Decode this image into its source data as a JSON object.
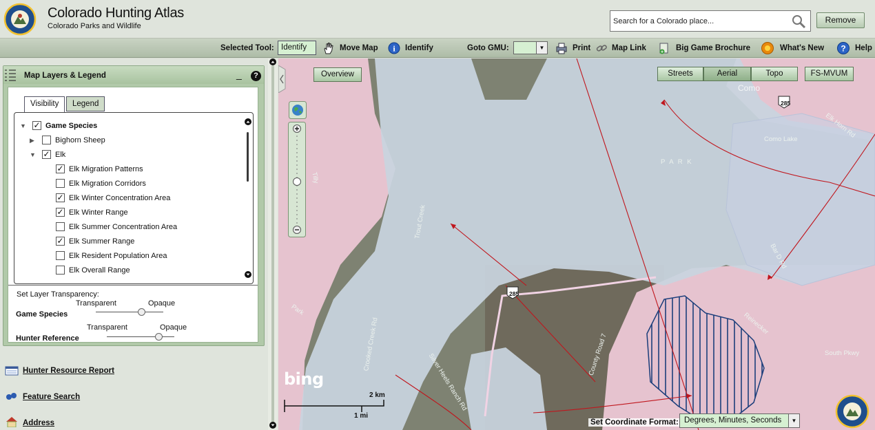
{
  "header": {
    "title": "Colorado Hunting Atlas",
    "subtitle": "Colorado Parks and Wildlife",
    "logo_text": "COLORADO PARKS & WILDLIFE",
    "search_placeholder": "Search for a Colorado place...",
    "remove_label": "Remove"
  },
  "toolbar": {
    "selected_tool_label": "Selected Tool:",
    "selected_tool_value": "Identify",
    "move_map": "Move Map",
    "identify": "Identify",
    "goto_gmu": "Goto GMU:",
    "print": "Print",
    "map_link": "Map Link",
    "big_game": "Big Game Brochure",
    "whats_new": "What's New",
    "help": "Help"
  },
  "layers_panel": {
    "title": "Map Layers & Legend",
    "minimize": "_",
    "help": "?",
    "tabs": [
      "Visibility",
      "Legend"
    ],
    "tree": [
      {
        "label": "Game Species",
        "checked": true,
        "bold": true,
        "expanded": true
      },
      {
        "label": "Bighorn Sheep",
        "checked": false,
        "expanded": false
      },
      {
        "label": "Elk",
        "checked": true,
        "expanded": true
      },
      {
        "label": "Elk Migration Patterns",
        "checked": true
      },
      {
        "label": "Elk Migration Corridors",
        "checked": false
      },
      {
        "label": "Elk Winter Concentration Area",
        "checked": true
      },
      {
        "label": "Elk Winter Range",
        "checked": true
      },
      {
        "label": "Elk Summer Concentration Area",
        "checked": false
      },
      {
        "label": "Elk Summer Range",
        "checked": true
      },
      {
        "label": "Elk Resident Population Area",
        "checked": false
      },
      {
        "label": "Elk Overall Range",
        "checked": false
      }
    ],
    "transparency_title": "Set Layer Transparency:",
    "transparent": "Transparent",
    "opaque": "Opaque",
    "sliders": [
      {
        "label": "Game Species",
        "value": 0.7
      },
      {
        "label": "Hunter Reference",
        "value": 0.8
      }
    ]
  },
  "links": [
    "Hunter Resource Report",
    "Feature Search",
    "Address"
  ],
  "map": {
    "overview": "Overview",
    "basemaps": [
      "Streets",
      "Aerial",
      "Topo"
    ],
    "active_basemap": "Aerial",
    "fs_mvum": "FS-MVUM",
    "scale_km": "2 km",
    "scale_mi": "1 mi",
    "bing": "bing",
    "zoom_level": 0.5,
    "labels": [
      "Como",
      "Elk Horn Rd",
      "Como Lake",
      "P A R K",
      "Tilly",
      "Trout Creek",
      "Crooked Creek Rd",
      "Silver Heels Ranch Rd",
      "County Road 7",
      "Reinecker",
      "South Pkwy",
      "Bar D Rd",
      "Park",
      "285",
      "285"
    ],
    "coord_label": "Set Coordinate Format:",
    "coord_value": "Degrees, Minutes, Seconds"
  }
}
